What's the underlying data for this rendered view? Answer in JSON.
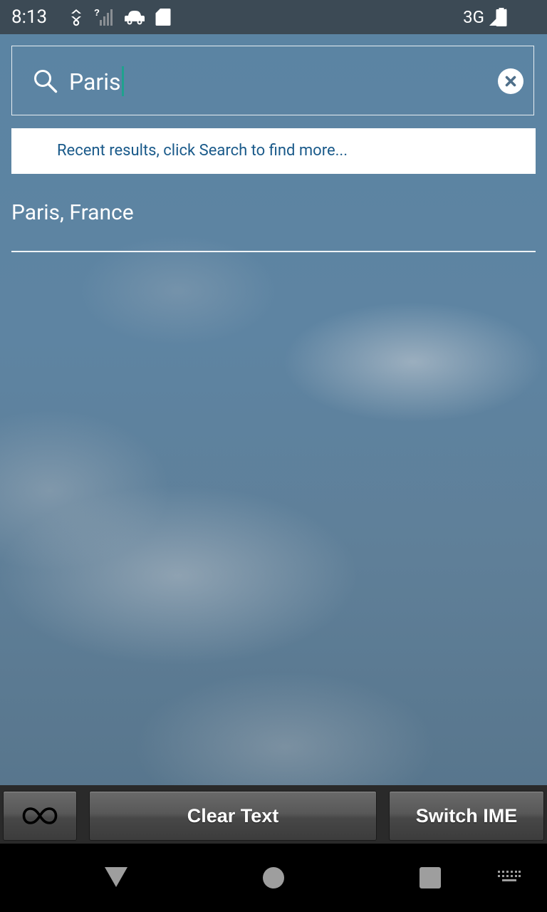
{
  "status_bar": {
    "time": "8:13",
    "network": "3G",
    "icons": [
      "download-icon",
      "no-signal-icon",
      "car-icon",
      "sd-card-icon",
      "signal-icon",
      "battery-icon"
    ]
  },
  "search": {
    "query": "Paris",
    "icon": "search-icon",
    "clear_icon": "clear-icon"
  },
  "recent_banner": {
    "text": "Recent results, click Search to find more..."
  },
  "results": [
    {
      "label": "Paris, France"
    }
  ],
  "toolbar": {
    "infinity_icon": "infinity-icon",
    "clear_text_label": "Clear Text",
    "switch_ime_label": "Switch IME"
  },
  "nav_bar": {
    "icons": [
      "back-icon",
      "home-icon",
      "recents-icon",
      "keyboard-icon"
    ]
  },
  "colors": {
    "status_bar": "#3c4a55",
    "sky": "#5e84a2",
    "recent_text": "#1a5a8a",
    "caret": "#1fa28e",
    "toolbar": "#2a2a2a"
  }
}
